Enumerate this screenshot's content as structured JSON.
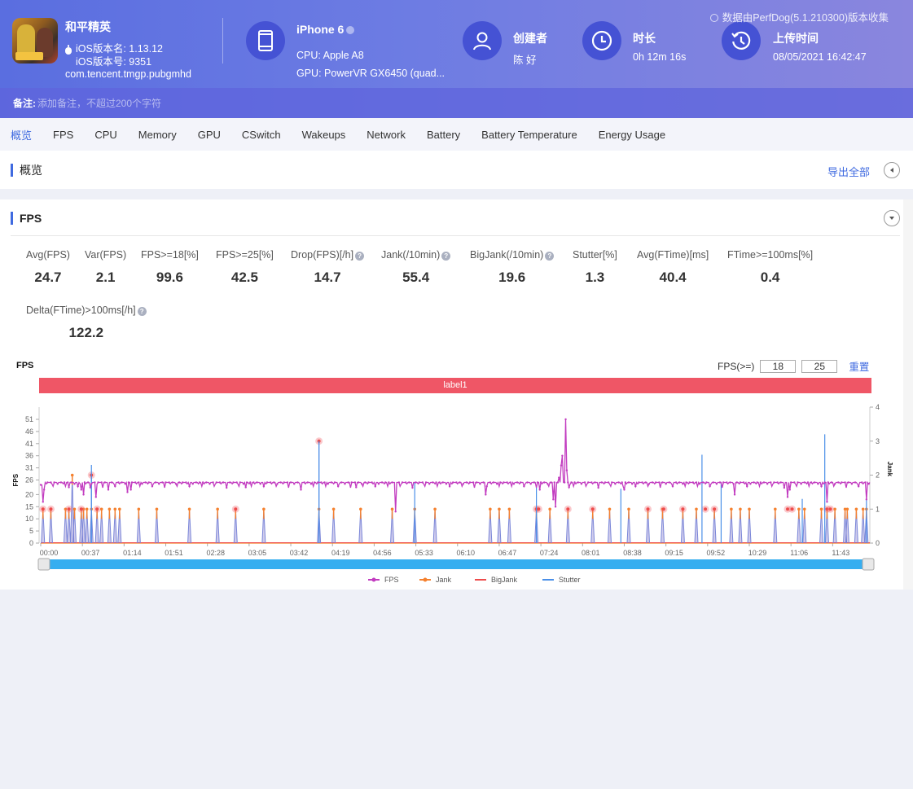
{
  "header": {
    "app_name": "和平精英",
    "ios_version_name": "iOS版本名: 1.13.12",
    "ios_version_code": "iOS版本号: 9351",
    "package": "com.tencent.tmgp.pubgmhd",
    "device_name": "iPhone 6",
    "cpu": "CPU: Apple A8",
    "gpu": "GPU: PowerVR GX6450 (quad...",
    "creator_label": "创建者",
    "creator_value": "陈 好",
    "duration_label": "时长",
    "duration_value": "0h 12m 16s",
    "upload_label": "上传时间",
    "upload_value": "08/05/2021 16:42:47",
    "collected_note": "数据由PerfDog(5.1.210300)版本收集"
  },
  "note": {
    "label": "备注:",
    "placeholder": "添加备注，不超过200个字符"
  },
  "tabs": [
    {
      "label": "概览",
      "active": true
    },
    {
      "label": "FPS"
    },
    {
      "label": "CPU"
    },
    {
      "label": "Memory"
    },
    {
      "label": "GPU"
    },
    {
      "label": "CSwitch"
    },
    {
      "label": "Wakeups"
    },
    {
      "label": "Network"
    },
    {
      "label": "Battery"
    },
    {
      "label": "Battery Temperature"
    },
    {
      "label": "Energy Usage"
    }
  ],
  "overview": {
    "title": "概览",
    "export_label": "导出全部"
  },
  "fps_section": {
    "title": "FPS",
    "metrics": [
      {
        "label": "Avg(FPS)",
        "value": "24.7",
        "help": false
      },
      {
        "label": "Var(FPS)",
        "value": "2.1",
        "help": false
      },
      {
        "label": "FPS>=18[%]",
        "value": "99.6",
        "help": false
      },
      {
        "label": "FPS>=25[%]",
        "value": "42.5",
        "help": false
      },
      {
        "label": "Drop(FPS)[/h]",
        "value": "14.7",
        "help": true
      },
      {
        "label": "Jank(/10min)",
        "value": "55.4",
        "help": true
      },
      {
        "label": "BigJank(/10min)",
        "value": "19.6",
        "help": true
      },
      {
        "label": "Stutter[%]",
        "value": "1.3",
        "help": false
      },
      {
        "label": "Avg(FTime)[ms]",
        "value": "40.4",
        "help": false
      },
      {
        "label": "FTime>=100ms[%]",
        "value": "0.4",
        "help": false
      },
      {
        "label": "Delta(FTime)>100ms[/h]",
        "value": "122.2",
        "help": true
      }
    ],
    "chart_title": "FPS",
    "threshold_label": "FPS(>=)",
    "threshold_low": "18",
    "threshold_high": "25",
    "reset_label": "重置",
    "label_bar": "label1"
  },
  "colors": {
    "accent": "#3f6ae0",
    "fps": "#c23cc0",
    "jank": "#f5812f",
    "bigjank": "#ee4b4b",
    "stutter": "#4a8fe8",
    "label_bar": "#ef5666",
    "slider": "#35aef0"
  },
  "chart_data": {
    "type": "line",
    "title": "FPS",
    "xlabel": "",
    "ylabel": "FPS",
    "y2label": "Jank",
    "ylim": [
      0,
      53
    ],
    "y2lim": [
      0,
      4
    ],
    "yticks": [
      0,
      5,
      10,
      15,
      20,
      26,
      31,
      36,
      41,
      46,
      51
    ],
    "y2ticks": [
      0,
      1,
      2,
      3,
      4
    ],
    "xlim_seconds": [
      0,
      736
    ],
    "xticks": [
      "00:00",
      "00:37",
      "01:14",
      "01:51",
      "02:28",
      "03:05",
      "03:42",
      "04:19",
      "04:56",
      "05:33",
      "06:10",
      "06:47",
      "07:24",
      "08:01",
      "08:38",
      "09:15",
      "09:52",
      "10:29",
      "11:06",
      "11:43"
    ],
    "legend": [
      "FPS",
      "Jank",
      "BigJank",
      "Stutter"
    ],
    "legend_position": "bottom",
    "fps_baseline": 25,
    "fps_events": [
      {
        "t": 2,
        "v": 17
      },
      {
        "t": 3,
        "v": 22
      },
      {
        "t": 25,
        "v": 23
      },
      {
        "t": 36,
        "v": 22
      },
      {
        "t": 38,
        "v": 20
      },
      {
        "t": 44,
        "v": 23
      },
      {
        "t": 49,
        "v": 19
      },
      {
        "t": 60,
        "v": 22
      },
      {
        "t": 77,
        "v": 21
      },
      {
        "t": 80,
        "v": 22
      },
      {
        "t": 182,
        "v": 23
      },
      {
        "t": 231,
        "v": 22
      },
      {
        "t": 280,
        "v": 23
      },
      {
        "t": 315,
        "v": 13
      },
      {
        "t": 395,
        "v": 20
      },
      {
        "t": 443,
        "v": 22
      },
      {
        "t": 455,
        "v": 18
      },
      {
        "t": 457,
        "v": 15
      },
      {
        "t": 460,
        "v": 27
      },
      {
        "t": 462,
        "v": 32
      },
      {
        "t": 463,
        "v": 36
      },
      {
        "t": 465,
        "v": 25
      },
      {
        "t": 466,
        "v": 51
      },
      {
        "t": 467,
        "v": 30
      },
      {
        "t": 469,
        "v": 23
      },
      {
        "t": 518,
        "v": 22
      },
      {
        "t": 616,
        "v": 20
      },
      {
        "t": 663,
        "v": 19
      },
      {
        "t": 665,
        "v": 22
      },
      {
        "t": 698,
        "v": 17
      },
      {
        "t": 733,
        "v": 18
      }
    ],
    "jank_events_t": [
      2,
      9,
      22,
      25,
      28,
      30,
      36,
      38,
      41,
      45,
      50,
      54,
      61,
      66,
      70,
      87,
      103,
      132,
      157,
      173,
      198,
      247,
      260,
      284,
      312,
      332,
      350,
      399,
      407,
      416,
      440,
      452,
      468,
      490,
      505,
      522,
      539,
      552,
      570,
      582,
      598,
      613,
      621,
      629,
      652,
      673,
      678,
      693,
      698,
      705,
      714,
      716,
      724,
      730,
      733
    ],
    "jank_values": {
      "default": 1,
      "2": [
        28,
        315,
        395,
        692
      ],
      "0": []
    },
    "bigjank_events_t": [
      2,
      9,
      25,
      36,
      45,
      50,
      173,
      247,
      440,
      442,
      468,
      490,
      539,
      553,
      570,
      590,
      598,
      663,
      667,
      698,
      701
    ],
    "bigjank_values": {
      "default": 1,
      "2": [
        45,
        678
      ],
      "3": [
        247
      ]
    },
    "stutter_spikes": [
      {
        "t": 45,
        "v": 2.3
      },
      {
        "t": 247,
        "v": 3.0
      },
      {
        "t": 332,
        "v": 1.8
      },
      {
        "t": 440,
        "v": 1.7
      },
      {
        "t": 515,
        "v": 1.6
      },
      {
        "t": 587,
        "v": 2.6
      },
      {
        "t": 604,
        "v": 1.8
      },
      {
        "t": 676,
        "v": 1.3
      },
      {
        "t": 696,
        "v": 3.2
      },
      {
        "t": 733,
        "v": 1.3
      }
    ],
    "bigjank_line": 0,
    "slider": {
      "start": 0,
      "end": 1
    }
  }
}
